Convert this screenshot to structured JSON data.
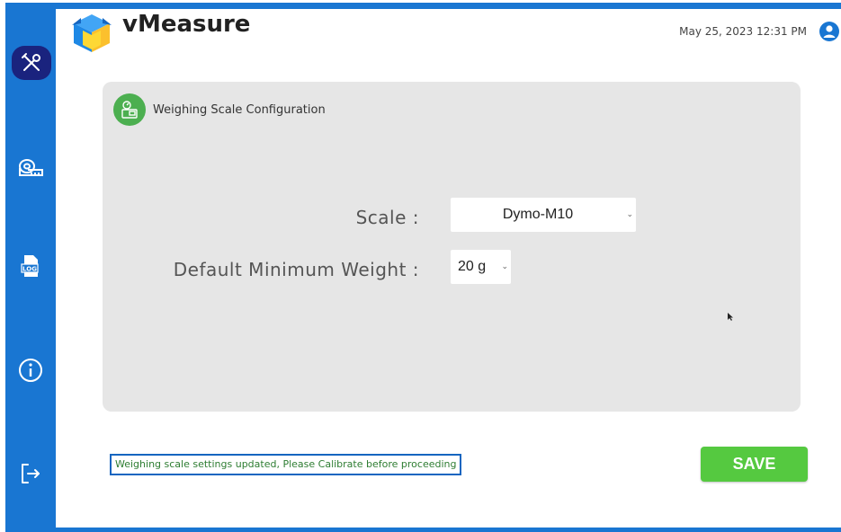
{
  "app": {
    "title": "vMeasure"
  },
  "header": {
    "datetime": "May 25, 2023 12:31 PM"
  },
  "sidebar": {
    "items": [
      {
        "icon": "tools-icon",
        "active": true
      },
      {
        "icon": "measuring-tape-icon",
        "active": false
      },
      {
        "icon": "log-icon",
        "label": "LOG",
        "active": false
      },
      {
        "icon": "info-icon",
        "active": false
      },
      {
        "icon": "logout-icon",
        "active": false
      }
    ]
  },
  "panel": {
    "title": "Weighing Scale Configuration",
    "fields": {
      "scale": {
        "label": "Scale :",
        "value": "Dymo-M10"
      },
      "min_weight": {
        "label": "Default Minimum Weight :",
        "value": "20 g"
      }
    }
  },
  "status": {
    "message": "Weighing scale settings updated, Please Calibrate before proceeding"
  },
  "actions": {
    "save_label": "SAVE"
  },
  "colors": {
    "sidebar": "#1976d2",
    "active_nav": "#1a237e",
    "save_button": "#55c940",
    "status_text": "#2e7d32",
    "panel_bg": "#e6e6e6"
  }
}
